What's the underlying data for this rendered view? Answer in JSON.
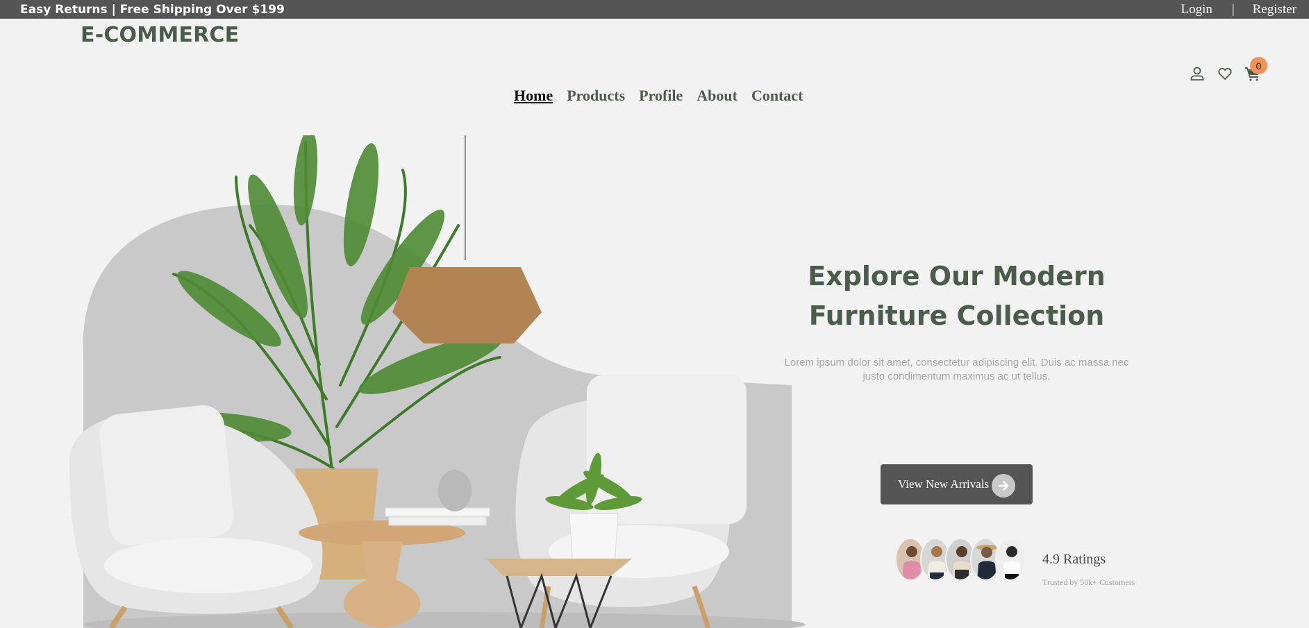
{
  "topbar": {
    "promo": "Easy Returns | Free Shipping Over $199",
    "login": "Login",
    "separator": "|",
    "register": "Register"
  },
  "brand": {
    "logo": "E-COMMERCE"
  },
  "nav": {
    "items": [
      {
        "label": "Home",
        "active": true
      },
      {
        "label": "Products"
      },
      {
        "label": "Profile"
      },
      {
        "label": "About"
      },
      {
        "label": "Contact"
      }
    ]
  },
  "header_icons": {
    "user": "user-icon",
    "wishlist": "heart-icon",
    "cart": "cart-icon",
    "cart_count": "0"
  },
  "hero": {
    "title_line1": "Explore Our Modern",
    "title_line2": "Furniture Collection",
    "subtitle": "Lorem ipsum dolor sit amet, consectetur adipiscing elit. Duis ac massa nec justo condimentum maximus ac ut tellus.",
    "cta_label": "View New Arrivals",
    "cta_icon": "arrow-right-icon",
    "rating": "4.9 Ratings",
    "trusted": "Trusted by 50k+ Customers"
  },
  "colors": {
    "topbar": "#555555",
    "brand": "#4b5c4c",
    "badge": "#f0935b",
    "background": "#f2f2f2"
  }
}
